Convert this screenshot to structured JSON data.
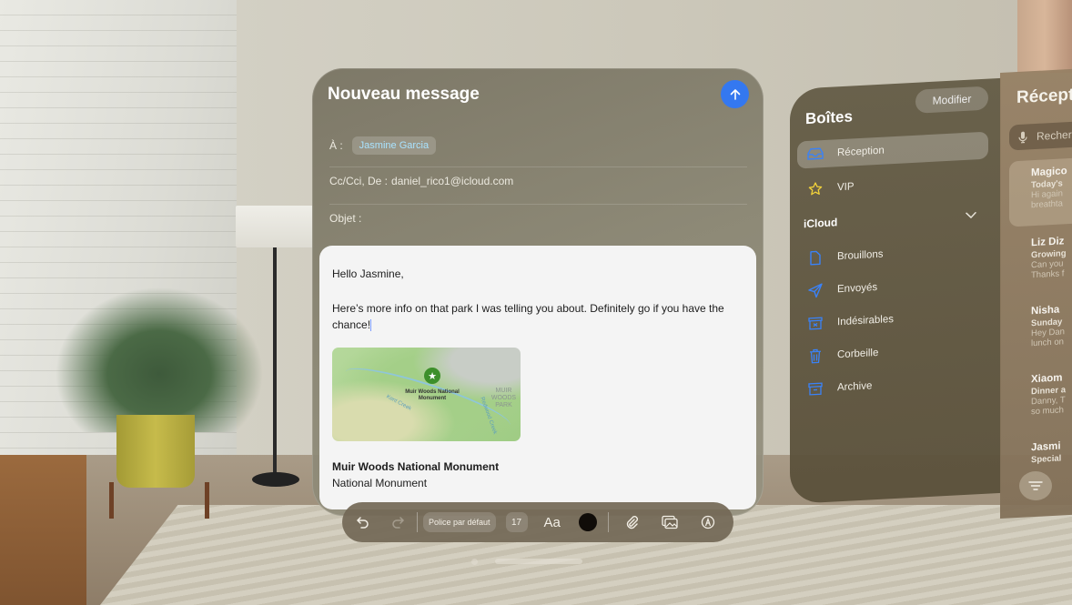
{
  "compose": {
    "title": "Nouveau message",
    "send_icon": "arrow-up-icon",
    "to_label": "À :",
    "to_recipient": "Jasmine Garcia",
    "cc_label": "Cc/Cci, De :",
    "from_value": "daniel_rico1@icloud.com",
    "subject_label": "Objet :",
    "subject_value": "",
    "body": {
      "greeting": "Hello Jasmine,",
      "paragraph": "Here’s more info on that park I was telling you about. Definitely go if you have the chance!",
      "map": {
        "pin_label": "Muir Woods National Monument",
        "park_label": "MUIR WOODS PARK",
        "creek_label": "Kent Creek",
        "creek2_label": "Redwood Creek"
      },
      "place_name": "Muir Woods National Monument",
      "place_type": "National Monument"
    }
  },
  "toolbar": {
    "undo_icon": "undo-icon",
    "redo_icon": "redo-icon",
    "font_label": "Police par défaut",
    "font_size": "17",
    "text_style_label": "Aa",
    "text_color": "#100c08",
    "attach_icon": "paperclip-icon",
    "photo_icon": "photo-library-icon",
    "markup_icon": "markup-icon"
  },
  "sidebar": {
    "title": "Boîtes",
    "edit_label": "Modifier",
    "items": [
      {
        "label": "Réception",
        "icon": "inbox-icon",
        "active": true
      },
      {
        "label": "VIP",
        "icon": "star-icon",
        "active": false
      }
    ],
    "section": "iCloud",
    "icloud_items": [
      {
        "label": "Brouillons",
        "icon": "document-icon"
      },
      {
        "label": "Envoyés",
        "icon": "paperplane-icon"
      },
      {
        "label": "Indésirables",
        "icon": "junk-icon"
      },
      {
        "label": "Corbeille",
        "icon": "trash-icon"
      },
      {
        "label": "Archive",
        "icon": "archive-icon"
      }
    ]
  },
  "message_list": {
    "title": "Réception",
    "search_placeholder": "Rechercher",
    "messages": [
      {
        "from": "Magico",
        "subject": "Today's",
        "preview": "Hi again breathta"
      },
      {
        "from": "Liz Diz",
        "subject": "Growing",
        "preview": "Can you Thanks f"
      },
      {
        "from": "Nisha",
        "subject": "Sunday",
        "preview": "Hey Dan lunch on"
      },
      {
        "from": "Xiaom",
        "subject": "Dinner a",
        "preview": "Danny, T so much"
      },
      {
        "from": "Jasmi",
        "subject": "Special",
        "preview": ""
      }
    ],
    "filter_icon": "filter-icon"
  },
  "colors": {
    "accent": "#3478f0",
    "recipient_chip_text": "#a9e3ff",
    "vip_star": "#f2d23a",
    "mailbox_icon": "#3a82f7"
  }
}
